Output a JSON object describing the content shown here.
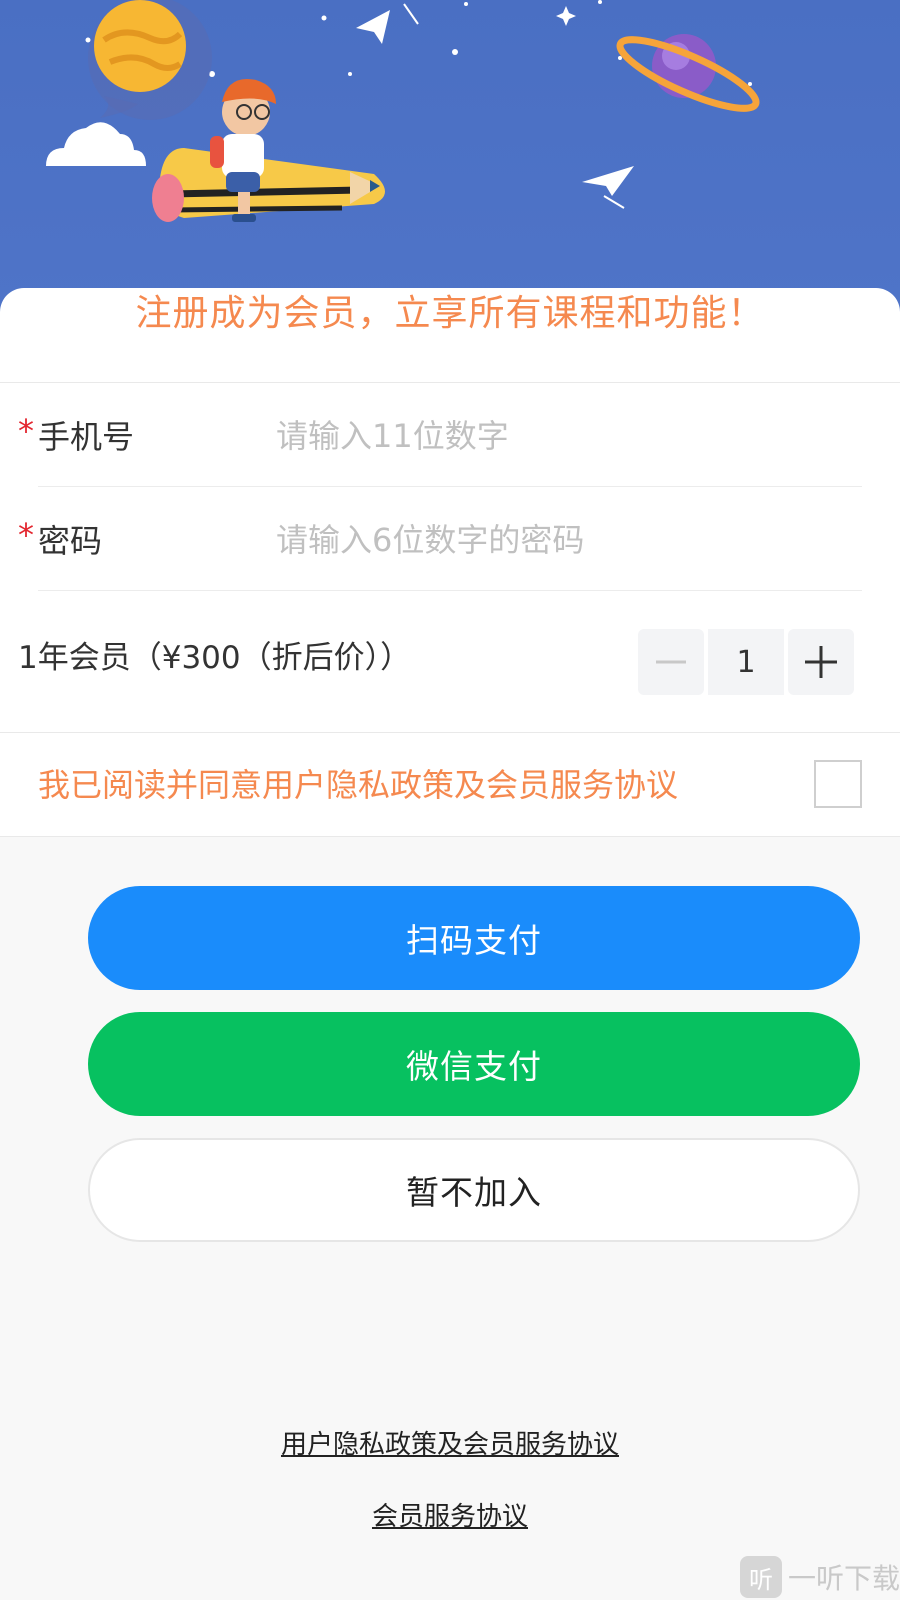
{
  "header": {
    "slogan": "注册成为会员，立享所有课程和功能！"
  },
  "form": {
    "phone": {
      "required_mark": "*",
      "label": "手机号",
      "placeholder": "请输入11位数字",
      "value": ""
    },
    "password": {
      "required_mark": "*",
      "label": "密码",
      "placeholder": "请输入6位数字的密码",
      "value": ""
    }
  },
  "membership": {
    "label": "1年会员（¥300（折后价））",
    "quantity": "1",
    "decrement_icon": "minus-icon",
    "increment_icon": "plus-icon"
  },
  "agreement": {
    "text": "我已阅读并同意用户隐私政策及会员服务协议",
    "checked": false
  },
  "buttons": {
    "scan_pay": "扫码支付",
    "wechat_pay": "微信支付",
    "skip": "暂不加入"
  },
  "links": {
    "privacy": "用户隐私政策及会员服务协议",
    "service": "会员服务协议"
  },
  "watermark": {
    "logo": "听",
    "text": "一听下载"
  },
  "colors": {
    "banner_bg": "#4d72c6",
    "accent_orange": "#f5894f",
    "required_red": "#e3262f",
    "scan_blue": "#1a8cfb",
    "wechat_green": "#07c160"
  }
}
